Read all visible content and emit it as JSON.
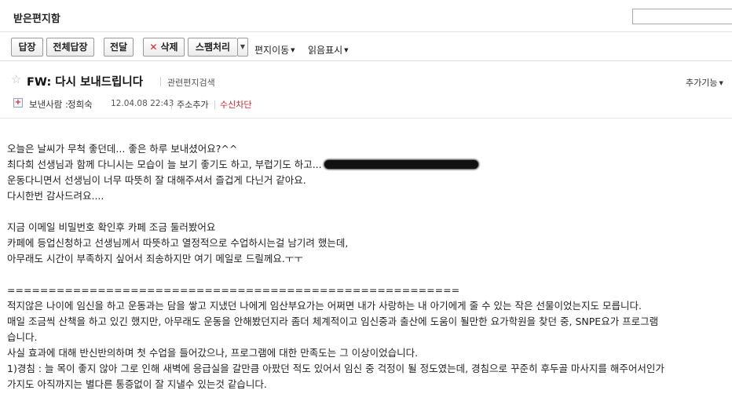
{
  "header": {
    "folder_title": "받은편지함"
  },
  "toolbar": {
    "reply": "답장",
    "reply_all": "전체답장",
    "forward": "전달",
    "delete": "삭제",
    "spam": "스팸처리",
    "move": "편지이동",
    "read_mark": "읽음표시"
  },
  "message": {
    "subject": "FW: 다시 보내드립니다",
    "related_search": "관련편지검색",
    "more_functions": "추가기능",
    "sender_label": "보낸사람 :",
    "sender_name": "정희숙",
    "date": "12.04.08 22:43",
    "add_address": "주소추가",
    "block_receive": "수신차단"
  },
  "body": {
    "l1": "오늘은 날씨가 무척 좋던데... 좋은 하루 보내셨어요?^^",
    "l2": "최다희 선생님과 함께 다니시는 모습이 늘 보기 좋기도 하고, 부럽기도 하고...",
    "l3": "운동다니면서 선생님이 너무 따뜻히 잘 대해주셔서 즐겁게 다닌거 같아요.",
    "l4": "다시한번 감사드려요....",
    "l5": "지금 이메일 비밀번호 확인후 카페 조금 둘러봤어요",
    "l6": "카페에 등업신청하고 선생님께서 따뜻하고 열정적으로 수업하시는걸 남기려 했는데,",
    "l7": "아무래도 시간이 부족하지 싶어서 죄송하지만 여기 메일로 드릴께요.ㅜㅜ",
    "l8": "=======================================================",
    "l9": "적지않은 나이에 임신을 하고 운동과는 담을 쌓고 지냈던 나에게 임산부요가는 어쩌면 내가 사랑하는 내 아기에게 줄 수 있는 작은 선물이었는지도 모릅니다.",
    "l10": "매일 조금씩 산책을 하고 있긴 했지만, 아무래도 운동을 안해봤던지라 좀더 체계적이고 임신중과 출산에 도움이 될만한 요가학원을 찾던 중, SNPE요가 프로그램",
    "l11": "습니다.",
    "l12": "사실 효과에 대해 반신반의하며 첫 수업을 들어갔으나, 프로그램에 대한 만족도는 그 이상이었습니다.",
    "l13": "1)경침 : 늘 목이 좋지 않아 그로 인해 새벽에 응급실을 갈만큼 아팠던 적도 있어서 임신 중 걱정이 될 정도였는데, 경침으로 꾸준히 후두골 마사지를 해주어서인가",
    "l14": "가지도 아직까지는 별다른 통증없이 잘 지낼수 있는것 같습니다."
  }
}
